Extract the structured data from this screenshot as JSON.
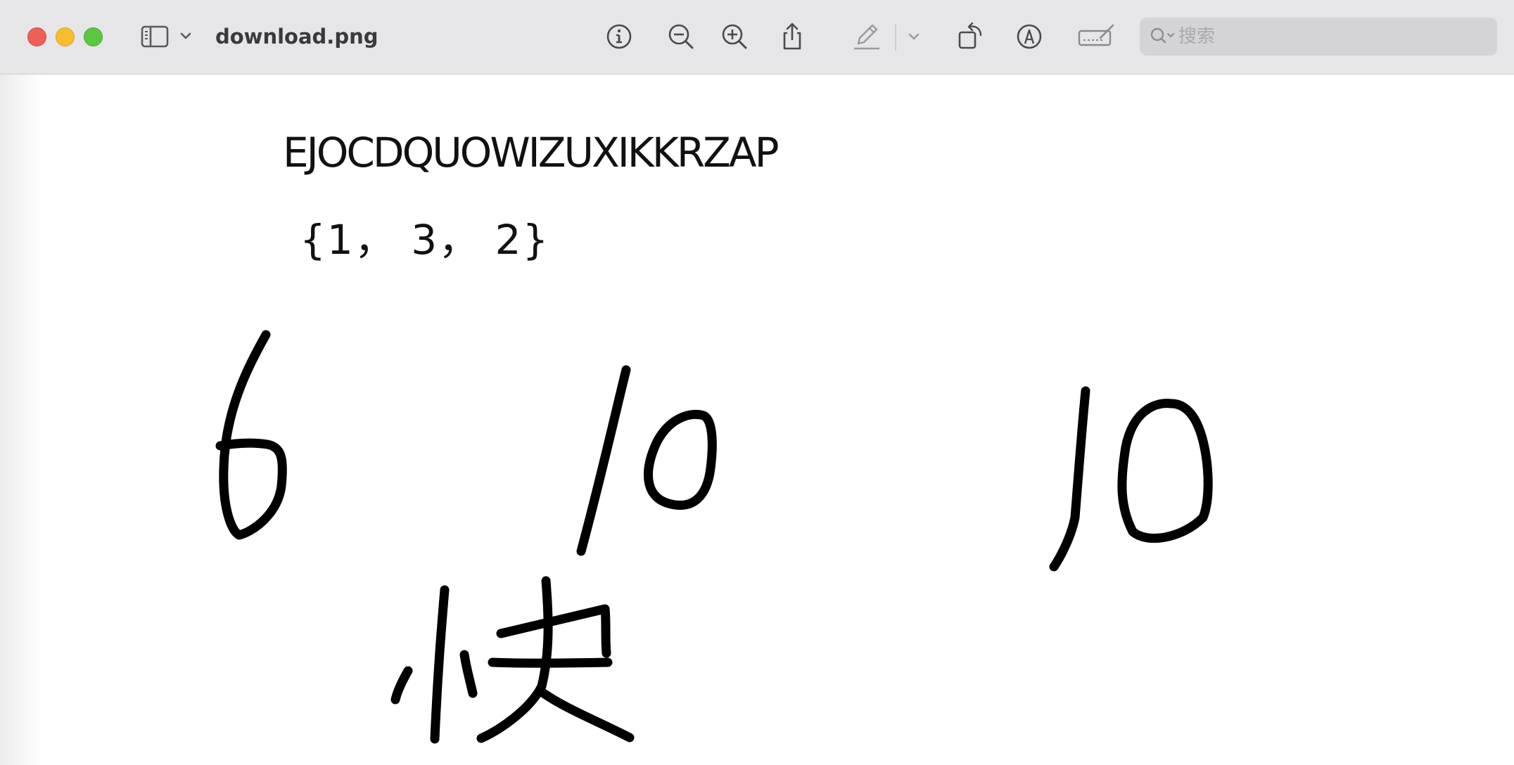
{
  "window": {
    "title": "download.png"
  },
  "toolbar": {
    "buttons": [
      {
        "name": "sidebar-toggle",
        "icon": "sidebar-icon"
      },
      {
        "name": "info",
        "icon": "info-icon"
      },
      {
        "name": "zoom-out",
        "icon": "zoom-out-icon"
      },
      {
        "name": "zoom-in",
        "icon": "zoom-in-icon"
      },
      {
        "name": "share",
        "icon": "share-icon"
      },
      {
        "name": "highlight",
        "icon": "pencil-icon"
      },
      {
        "name": "rotate",
        "icon": "rotate-icon"
      },
      {
        "name": "markup",
        "icon": "markup-icon"
      },
      {
        "name": "sign",
        "icon": "signature-icon"
      }
    ],
    "search": {
      "placeholder": "搜索"
    }
  },
  "image": {
    "line1": "EJOCDQUOWIZUXIKKRZAP",
    "line2": "{1， 3， 2}",
    "handwritten": [
      "6",
      "10",
      "10",
      "快"
    ]
  },
  "colors": {
    "toolbar_bg": "#e6e6e8",
    "close": "#ee5f57",
    "minimize": "#f6be2e",
    "maximize": "#5cc73f"
  }
}
